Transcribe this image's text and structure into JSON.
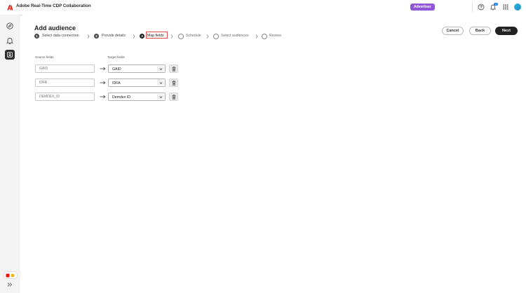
{
  "header": {
    "app_title": "Adobe Real-Time CDP Collaboration",
    "role_badge": "Advertiser",
    "notification_count": "1",
    "icons": [
      "adobe-logo-icon",
      "help-icon",
      "bell-icon",
      "app-grid-icon",
      "user-avatar"
    ]
  },
  "left_rail": {
    "items": [
      {
        "icon": "compass-icon",
        "active": false
      },
      {
        "icon": "bell-outline-icon",
        "active": false
      },
      {
        "icon": "audience-icon",
        "active": true
      }
    ],
    "bottom_icons": [
      "workspace-switcher-icon",
      "expand-rail-icon"
    ]
  },
  "page": {
    "title": "Add audience",
    "steps": [
      {
        "number": "1",
        "label": "Select data connection",
        "state": "done"
      },
      {
        "number": "2",
        "label": "Provide details",
        "state": "done"
      },
      {
        "number": "3",
        "label": "Map fields",
        "state": "current"
      },
      {
        "number": "",
        "label": "Schedule",
        "state": "todo"
      },
      {
        "number": "",
        "label": "Select audiences",
        "state": "todo"
      },
      {
        "number": "",
        "label": "Review",
        "state": "todo"
      }
    ],
    "buttons": {
      "cancel": "Cancel",
      "back": "Back",
      "next": "Next"
    }
  },
  "mapping": {
    "source_header": "Source fields",
    "target_header": "Target fields",
    "rows": [
      {
        "source_placeholder": "GAID",
        "target_value": "GAID"
      },
      {
        "source_placeholder": "IDFA",
        "target_value": "IDFA"
      },
      {
        "source_placeholder": "DEMDEX_ID",
        "target_value": "Demdex ID"
      }
    ]
  },
  "colors": {
    "accent_badge": "#9256d9",
    "primary_button": "#222222",
    "current_step_outline": "#e34850",
    "adobe_red": "#eb1000",
    "notification": "#2680eb"
  }
}
